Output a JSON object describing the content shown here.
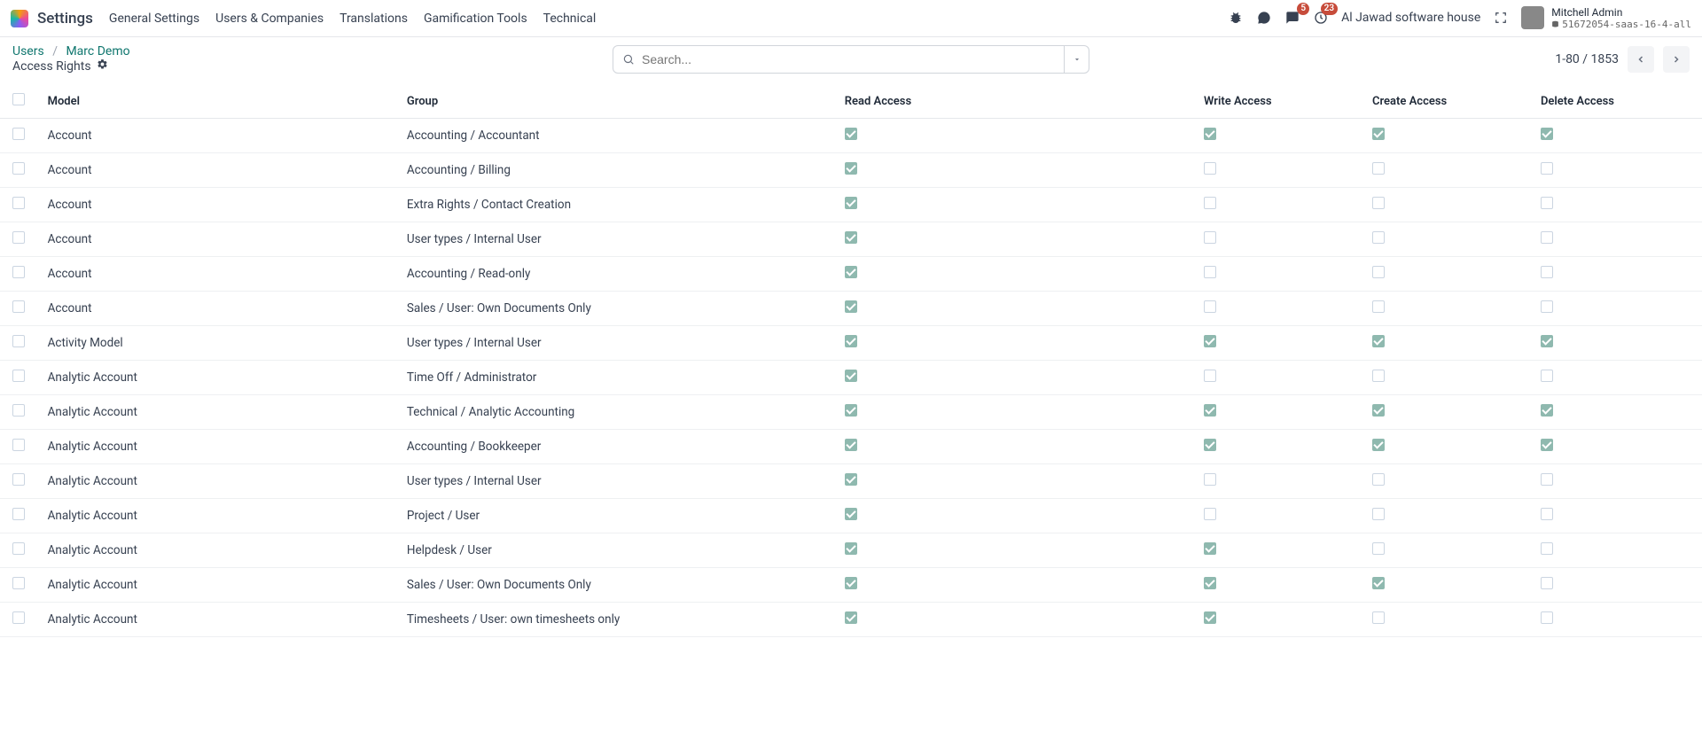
{
  "app": {
    "title": "Settings"
  },
  "nav": {
    "items": [
      "General Settings",
      "Users & Companies",
      "Translations",
      "Gamification Tools",
      "Technical"
    ]
  },
  "systray": {
    "messages_badge": "5",
    "activities_badge": "23",
    "company": "Al Jawad software house",
    "user_name": "Mitchell Admin",
    "db_name": "51672054-saas-16-4-all"
  },
  "breadcrumb": {
    "root": "Users",
    "current": "Marc Demo"
  },
  "page_subtitle": "Access Rights",
  "search": {
    "placeholder": "Search..."
  },
  "pager": {
    "text": "1-80 / 1853"
  },
  "table": {
    "headers": {
      "model": "Model",
      "group": "Group",
      "read": "Read Access",
      "write": "Write Access",
      "create": "Create Access",
      "delete": "Delete Access"
    },
    "rows": [
      {
        "model": "Account",
        "group": "Accounting / Accountant",
        "read": true,
        "write": true,
        "create": true,
        "delete": true
      },
      {
        "model": "Account",
        "group": "Accounting / Billing",
        "read": true,
        "write": false,
        "create": false,
        "delete": false
      },
      {
        "model": "Account",
        "group": "Extra Rights / Contact Creation",
        "read": true,
        "write": false,
        "create": false,
        "delete": false
      },
      {
        "model": "Account",
        "group": "User types / Internal User",
        "read": true,
        "write": false,
        "create": false,
        "delete": false
      },
      {
        "model": "Account",
        "group": "Accounting / Read-only",
        "read": true,
        "write": false,
        "create": false,
        "delete": false
      },
      {
        "model": "Account",
        "group": "Sales / User: Own Documents Only",
        "read": true,
        "write": false,
        "create": false,
        "delete": false
      },
      {
        "model": "Activity Model",
        "group": "User types / Internal User",
        "read": true,
        "write": true,
        "create": true,
        "delete": true
      },
      {
        "model": "Analytic Account",
        "group": "Time Off / Administrator",
        "read": true,
        "write": false,
        "create": false,
        "delete": false
      },
      {
        "model": "Analytic Account",
        "group": "Technical / Analytic Accounting",
        "read": true,
        "write": true,
        "create": true,
        "delete": true
      },
      {
        "model": "Analytic Account",
        "group": "Accounting / Bookkeeper",
        "read": true,
        "write": true,
        "create": true,
        "delete": true
      },
      {
        "model": "Analytic Account",
        "group": "User types / Internal User",
        "read": true,
        "write": false,
        "create": false,
        "delete": false
      },
      {
        "model": "Analytic Account",
        "group": "Project / User",
        "read": true,
        "write": false,
        "create": false,
        "delete": false
      },
      {
        "model": "Analytic Account",
        "group": "Helpdesk / User",
        "read": true,
        "write": true,
        "create": false,
        "delete": false
      },
      {
        "model": "Analytic Account",
        "group": "Sales / User: Own Documents Only",
        "read": true,
        "write": true,
        "create": true,
        "delete": false
      },
      {
        "model": "Analytic Account",
        "group": "Timesheets / User: own timesheets only",
        "read": true,
        "write": true,
        "create": false,
        "delete": false
      }
    ]
  }
}
